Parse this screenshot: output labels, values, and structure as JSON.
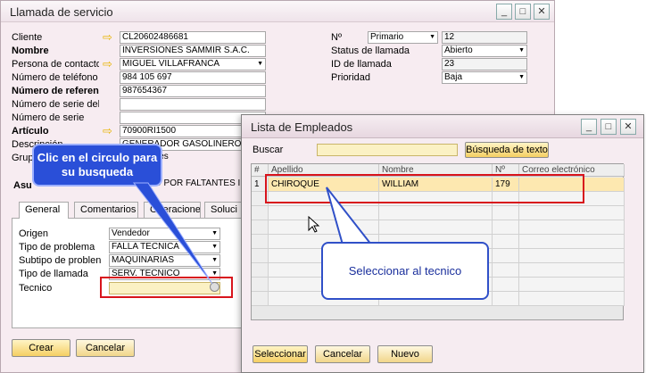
{
  "main_window": {
    "title": "Llamada de servicio",
    "left_fields": [
      {
        "label": "Cliente",
        "value": "CL20602486681",
        "bold": false,
        "arrow": true,
        "dropdown": false
      },
      {
        "label": "Nombre",
        "value": "INVERSIONES SAMMIR S.A.C.",
        "bold": true,
        "arrow": false,
        "dropdown": false
      },
      {
        "label": "Persona de contacto",
        "value": "MIGUEL VILLAFRANCA",
        "bold": false,
        "arrow": true,
        "dropdown": true
      },
      {
        "label": "Número de teléfono",
        "value": "984 105 697",
        "bold": false,
        "arrow": false,
        "dropdown": false
      },
      {
        "label": "Número de referen",
        "value": "987654367",
        "bold": true,
        "arrow": false,
        "dropdown": false
      },
      {
        "label": "Número de serie del fat",
        "value": "",
        "bold": false,
        "arrow": false,
        "dropdown": false
      },
      {
        "label": "Número de serie",
        "value": "",
        "bold": false,
        "arrow": false,
        "dropdown": false
      },
      {
        "label": "Artículo",
        "value": "70900RI1500",
        "bold": true,
        "arrow": true,
        "dropdown": false
      },
      {
        "label": "Descripción",
        "value": "GENERADOR GASOLINERO /",
        "bold": false,
        "arrow": false,
        "dropdown": false
      },
      {
        "label": "Grupo",
        "value": "…otaciones",
        "bold": false,
        "arrow": false,
        "dropdown": false
      }
    ],
    "right_fields": [
      {
        "label": "Nº",
        "select": "Primario",
        "value": "12",
        "dropdown": false
      },
      {
        "label": "Status de llamada",
        "value": "Abierto",
        "dropdown": true
      },
      {
        "label": "ID de llamada",
        "value": "23",
        "dropdown": false
      },
      {
        "label": "Prioridad",
        "value": "Baja",
        "dropdown": true
      }
    ],
    "asunto_label": "Asu",
    "asunto_value": "O POR FALTANTES I",
    "tabs": [
      "General",
      "Comentarios",
      "Operaciones",
      "Soluci"
    ],
    "general_fields": [
      {
        "label": "Origen",
        "value": "Vendedor"
      },
      {
        "label": "Tipo de problema",
        "value": "FALLA TECNICA"
      },
      {
        "label": "Subtipo de problen",
        "value": "MAQUINARIAS"
      },
      {
        "label": "Tipo de llamada",
        "value": "SERV. TECNICO"
      },
      {
        "label": "Tecnico",
        "value": ""
      }
    ],
    "buttons": {
      "create": "Crear",
      "cancel": "Cancelar"
    }
  },
  "employees_window": {
    "title": "Lista de Empleados",
    "search_label": "Buscar",
    "search_value": "",
    "search_button": "Búsqueda de texto",
    "columns": [
      "#",
      "Apellido",
      "Nombre",
      "Nº",
      "Correo electrónico"
    ],
    "rows": [
      {
        "num": "1",
        "apellido": "CHIROQUE",
        "nombre": "WILLIAM",
        "n": "179",
        "email": ""
      }
    ],
    "buttons": {
      "select": "Seleccionar",
      "cancel": "Cancelar",
      "new": "Nuevo"
    }
  },
  "annotations": {
    "callout1": "Clic en el circulo para su busqueda",
    "callout2": "Seleccionar al tecnico"
  }
}
